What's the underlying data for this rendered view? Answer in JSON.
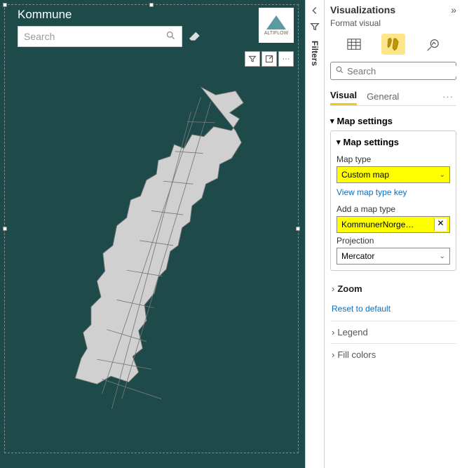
{
  "visual": {
    "title": "Kommune",
    "search_placeholder": "Search",
    "logo_label": "ALTIFLOW"
  },
  "toolbar": {
    "filter": "Filter",
    "focus": "Focus mode",
    "more": "···"
  },
  "filters_rail": {
    "label": "Filters"
  },
  "viz": {
    "title": "Visualizations",
    "subtitle": "Format visual",
    "search_placeholder": "Search",
    "tabs": {
      "visual": "Visual",
      "general": "General",
      "more": "···"
    },
    "sections": {
      "map_settings_outer": "Map settings",
      "map_settings_inner": "Map settings",
      "zoom": "Zoom",
      "legend": "Legend",
      "fill_colors": "Fill colors",
      "reset": "Reset to default"
    },
    "fields": {
      "map_type_label": "Map type",
      "map_type_value": "Custom map",
      "view_key": "View map type key",
      "add_map_label": "Add a map type",
      "add_map_value": "KommunerNorge…",
      "projection_label": "Projection",
      "projection_value": "Mercator"
    }
  }
}
